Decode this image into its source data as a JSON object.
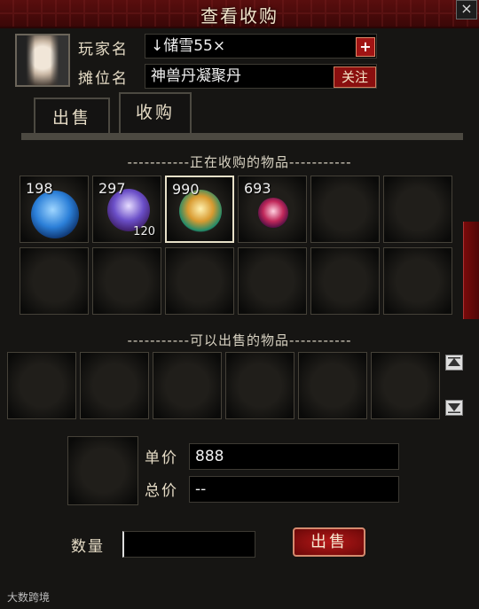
{
  "window": {
    "title": "查看收购",
    "close_label": "×"
  },
  "player": {
    "name_label": "玩家名",
    "name_value": "↓储雪55×",
    "add_label": "+",
    "stall_label": "摊位名",
    "stall_value": "神兽丹凝聚丹",
    "follow_label": "关注"
  },
  "tabs": [
    {
      "label": "出售",
      "active": false
    },
    {
      "label": "收购",
      "active": true
    }
  ],
  "buying_section": {
    "title": "-----------正在收购的物品-----------",
    "items": [
      {
        "count": "198",
        "sub": "",
        "icon": "blue-orb-icon",
        "color": "#2b7fd8"
      },
      {
        "count": "297",
        "sub": "120",
        "icon": "purple-orb-icon",
        "color": "#6b4fc8"
      },
      {
        "count": "990",
        "sub": "",
        "icon": "golden-orb-icon",
        "color": "#d89a30"
      },
      {
        "count": "693",
        "sub": "",
        "icon": "red-orb-icon",
        "color": "#c0285a"
      }
    ]
  },
  "sellable_section": {
    "title": "-----------可以出售的物品-----------"
  },
  "trade": {
    "price_label": "单价",
    "price_value": "888",
    "total_label": "总价",
    "total_value": "--",
    "qty_label": "数量",
    "qty_value": "",
    "sell_label": "出售"
  },
  "watermark": "大数跨境"
}
